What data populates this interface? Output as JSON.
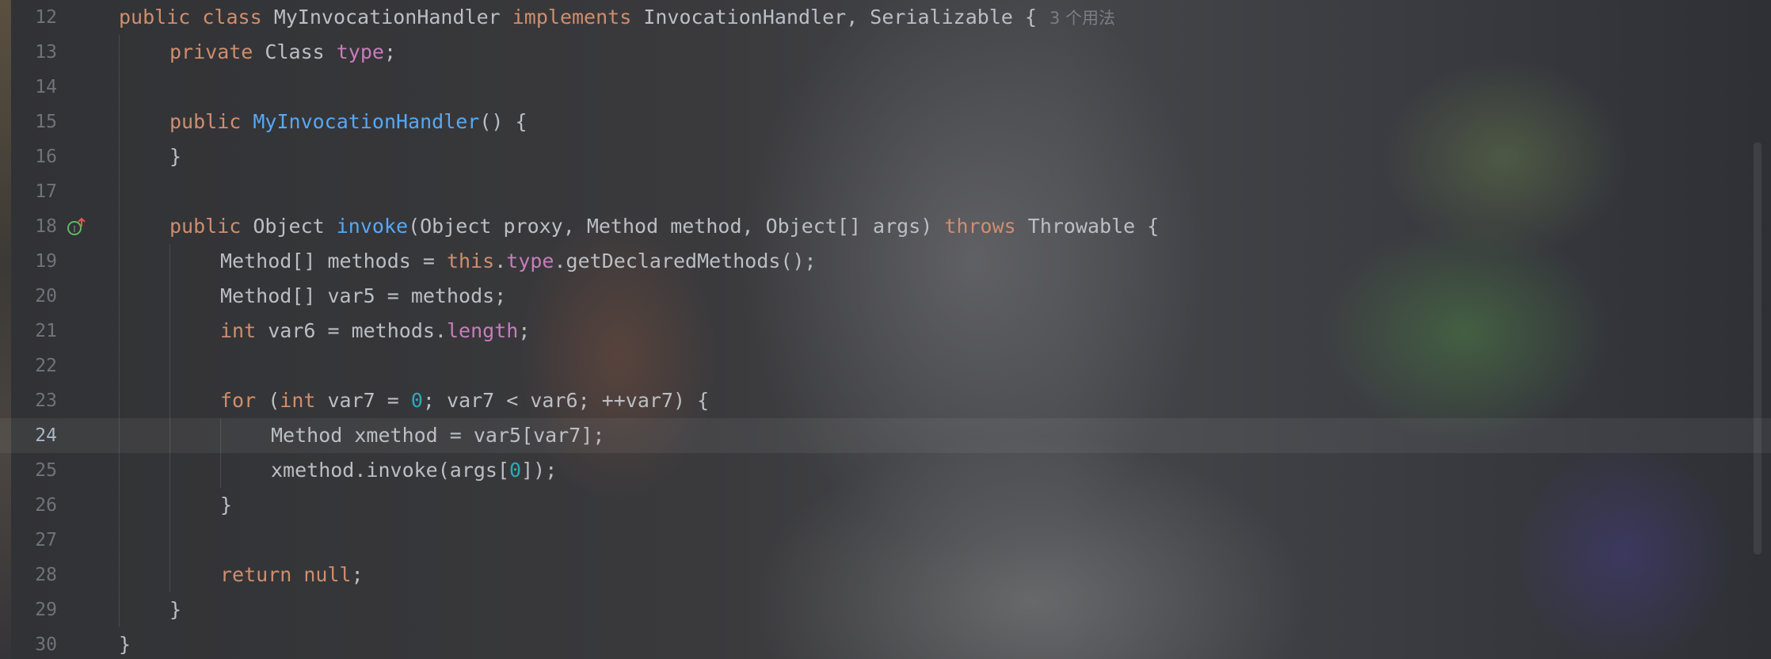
{
  "editor": {
    "inlay_hint": "3 个用法",
    "lines": [
      {
        "num": "12"
      },
      {
        "num": "13"
      },
      {
        "num": "14"
      },
      {
        "num": "15"
      },
      {
        "num": "16"
      },
      {
        "num": "17"
      },
      {
        "num": "18"
      },
      {
        "num": "19"
      },
      {
        "num": "20"
      },
      {
        "num": "21"
      },
      {
        "num": "22"
      },
      {
        "num": "23"
      },
      {
        "num": "24"
      },
      {
        "num": "25"
      },
      {
        "num": "26"
      },
      {
        "num": "27"
      },
      {
        "num": "28"
      },
      {
        "num": "29"
      },
      {
        "num": "30"
      }
    ],
    "tokens": {
      "l12": [
        "public",
        "class",
        "MyInvocationHandler",
        "implements",
        "InvocationHandler, Serializable {"
      ],
      "l13": [
        "private",
        "Class",
        "type",
        ";"
      ],
      "l15": [
        "public",
        "MyInvocationHandler",
        "() {"
      ],
      "l16": [
        "}"
      ],
      "l18": [
        "public",
        "Object",
        "invoke",
        "(Object proxy, Method method, Object[] args)",
        "throws",
        "Throwable {"
      ],
      "l19": [
        "Method[] methods = ",
        "this",
        ".",
        "type",
        ".getDeclaredMethods();"
      ],
      "l20": [
        "Method[] var5 = methods;"
      ],
      "l21": [
        "int",
        "var6 = methods.",
        "length",
        ";"
      ],
      "l23": [
        "for",
        "(",
        "int",
        "var7 = ",
        "0",
        "; var7 < var6; ++var7) {"
      ],
      "l24": [
        "Method xmethod = var5[var7];"
      ],
      "l25": [
        "xmethod.invoke(args[",
        "0",
        "]);"
      ],
      "l26": [
        "}"
      ],
      "l28": [
        "return",
        "null",
        ";"
      ],
      "l29": [
        "}"
      ],
      "l30": [
        "}"
      ]
    },
    "current_line": "24",
    "gutter_icon": "implements-override-icon",
    "colors": {
      "keyword": "#cf8e6d",
      "function": "#56a8f5",
      "field": "#c77dbb",
      "number": "#2aacb8",
      "text": "#bcbec4"
    }
  }
}
